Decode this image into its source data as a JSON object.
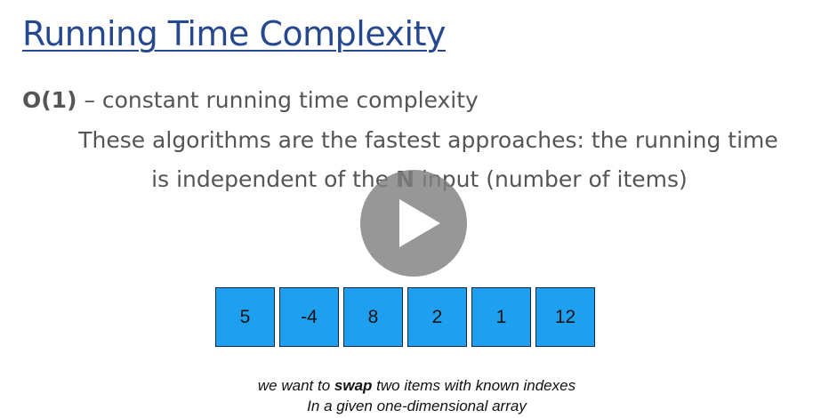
{
  "slide": {
    "title": "Running Time Complexity",
    "subtitle_bold": "O(1)",
    "subtitle_rest": " – constant running time complexity",
    "description_line1": "These algorithms are the fastest approaches: the running time",
    "description_line2_pre": "is independent of the ",
    "description_line2_bold": "N",
    "description_line2_post": " input (number of items)"
  },
  "array": {
    "values": [
      "5",
      "-4",
      "8",
      "2",
      "1",
      "12"
    ],
    "cell_color": "#1ea0f0"
  },
  "notes": {
    "line1_pre": "we want to ",
    "line1_bold": "swap",
    "line1_post": " two items with known indexes",
    "line2": "In a given one-dimensional array"
  },
  "player": {
    "play_icon": "play-icon"
  }
}
